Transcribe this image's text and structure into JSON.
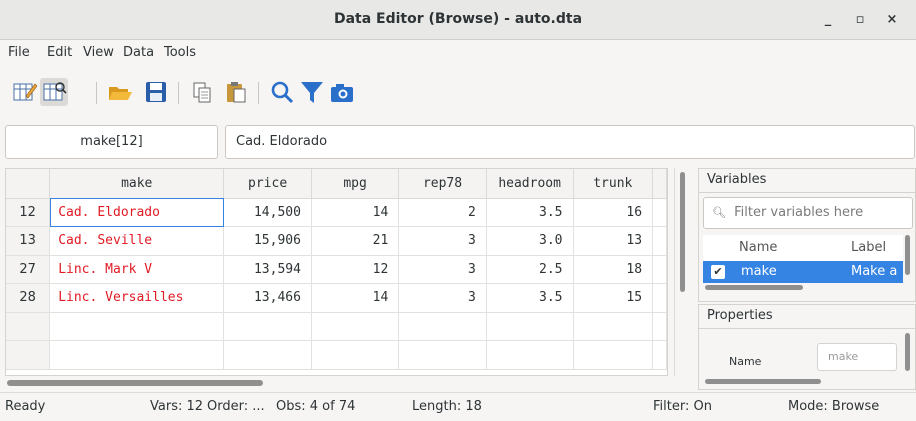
{
  "window": {
    "title": "Data Editor (Browse) - auto.dta",
    "minimize": "_",
    "maximize": "▫",
    "close": "×"
  },
  "menu": [
    "File",
    "Edit",
    "View",
    "Data",
    "Tools"
  ],
  "cell_ref": "make[12]",
  "cell_value": "Cad. Eldorado",
  "grid": {
    "columns": [
      "make",
      "price",
      "mpg",
      "rep78",
      "headroom",
      "trunk"
    ],
    "rows": [
      {
        "n": "12",
        "make": "Cad. Eldorado",
        "price": "14,500",
        "mpg": "14",
        "rep78": "2",
        "headroom": "3.5",
        "trunk": "16"
      },
      {
        "n": "13",
        "make": "Cad. Seville",
        "price": "15,906",
        "mpg": "21",
        "rep78": "3",
        "headroom": "3.0",
        "trunk": "13"
      },
      {
        "n": "27",
        "make": "Linc. Mark V",
        "price": "13,594",
        "mpg": "12",
        "rep78": "3",
        "headroom": "2.5",
        "trunk": "18"
      },
      {
        "n": "28",
        "make": "Linc. Versailles",
        "price": "13,466",
        "mpg": "14",
        "rep78": "3",
        "headroom": "3.5",
        "trunk": "15"
      }
    ]
  },
  "variables": {
    "title": "Variables",
    "filter_placeholder": "Filter variables here",
    "headers": {
      "name": "Name",
      "label": "Label"
    },
    "row": {
      "name": "make",
      "label": "Make a"
    }
  },
  "properties": {
    "title": "Properties",
    "name_label": "Name",
    "name_value": "make"
  },
  "status": {
    "ready": "Ready",
    "vars": "Vars: 12",
    "order": "Order: ...",
    "obs": "Obs: 4 of 74",
    "length": "Length: 18",
    "filter": "Filter: On",
    "mode": "Mode: Browse"
  }
}
